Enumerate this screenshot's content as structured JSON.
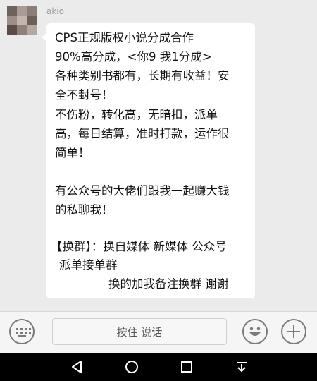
{
  "chat": {
    "sender_name": "akio",
    "message_lines": [
      "CPS正规版权小说分成合作",
      "90%高分成，<你9 我1分成>",
      "各种类别书都有，长期有收益！安",
      "全不封号！",
      "不伤粉，转化高，无暗扣，派单",
      "高，每日结算，准时打款，运作很",
      "简单！",
      "有公众号的大佬们跟我一起赚大钱",
      "的私聊我！",
      "【换群】：换自媒体 新媒体 公众号",
      "派单接单群",
      "换的加我备注换群   谢谢"
    ]
  },
  "input_bar": {
    "hold_to_talk_label": "按住 说话",
    "keyboard_icon": "keyboard-icon",
    "emoji_icon": "emoji-icon",
    "plus_icon": "plus-icon"
  },
  "nav_bar": {
    "icons": [
      "back-icon",
      "home-icon",
      "recents-icon",
      "notification-pulldown-icon"
    ]
  }
}
